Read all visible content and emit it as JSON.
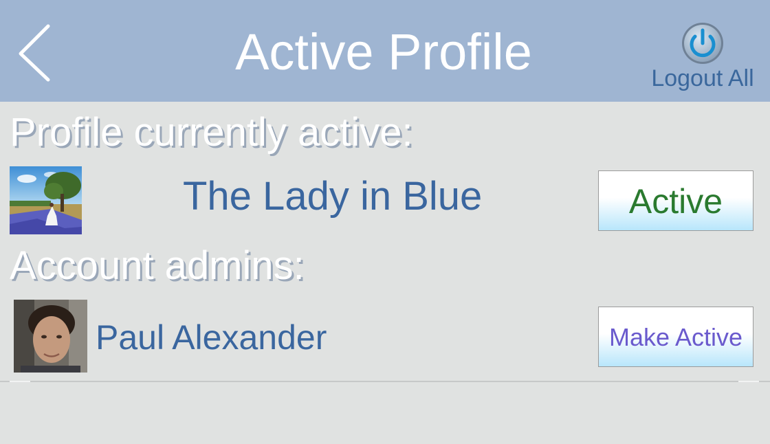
{
  "nav": {
    "title": "Active Profile",
    "logout_label": "Logout All"
  },
  "colors": {
    "navbar_bg": "#9fb5d2",
    "page_bg": "#e0e2e1",
    "name_text": "#3a669f",
    "active_text": "#2a7a2f",
    "make_active_text": "#6a5acd",
    "button_gradient_bottom": "#b8e6fb"
  },
  "current_profile": {
    "heading": "Profile currently active:",
    "name": "The Lady in Blue",
    "thumbnail": "landscape-with-bluebonnets-and-tree",
    "button_label": "Active"
  },
  "admins": {
    "heading": "Account admins:",
    "items": [
      {
        "name": "Paul Alexander",
        "thumbnail": "portrait-photo",
        "button_label": "Make Active"
      }
    ]
  }
}
